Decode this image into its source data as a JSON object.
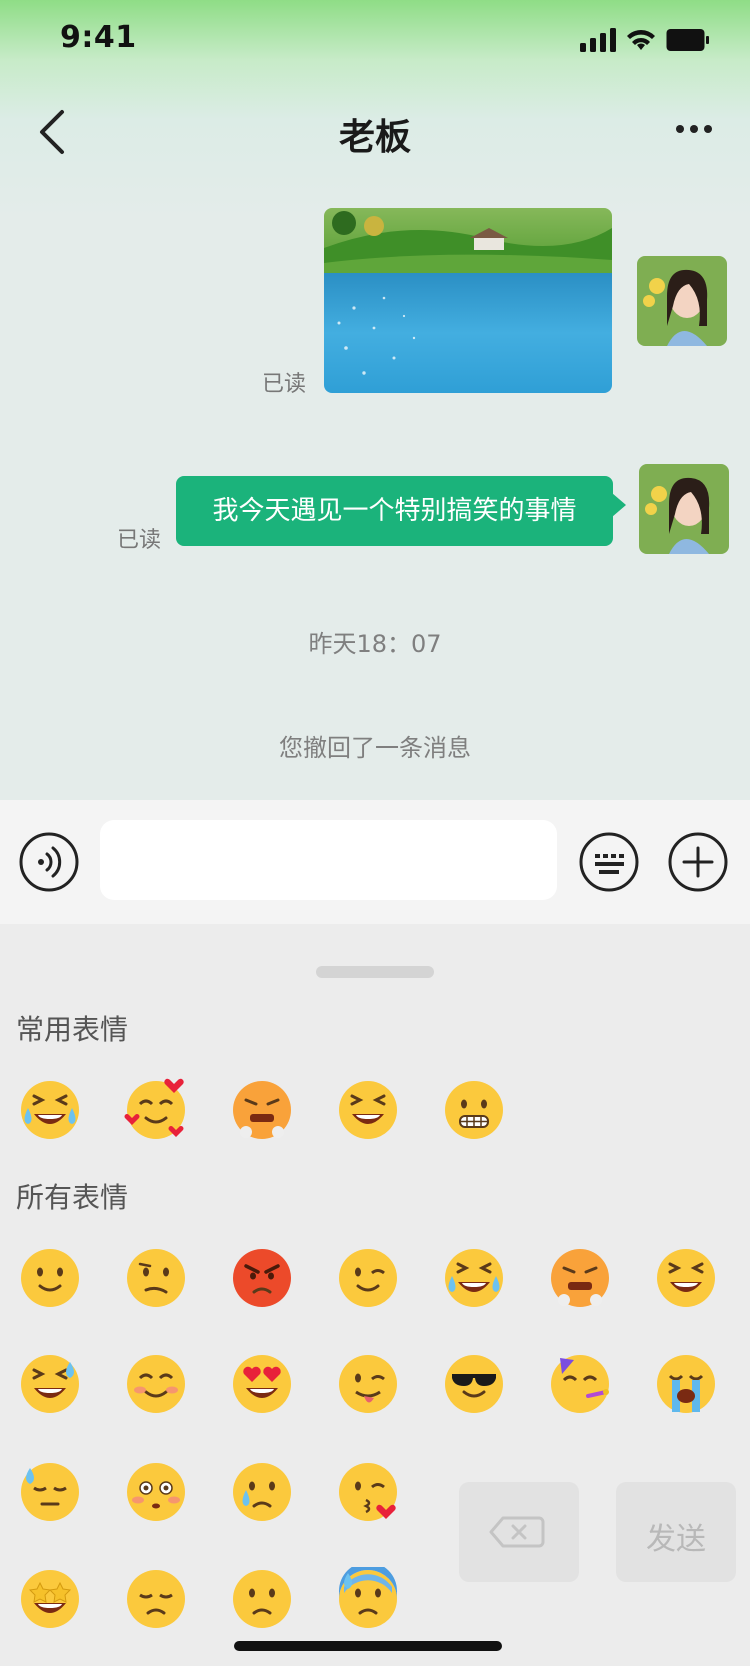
{
  "status_bar": {
    "time": "9:41"
  },
  "header": {
    "title": "老板"
  },
  "messages": {
    "read_label_1": "已读",
    "read_label_2": "已读",
    "text_message": "我今天遇见一个特别搞笑的事情",
    "timestamp": "昨天18：07",
    "recall_notice": "您撤回了一条消息"
  },
  "input": {
    "placeholder": ""
  },
  "emoji_panel": {
    "frequent_title": "常用表情",
    "all_title": "所有表情",
    "frequent": [
      "tears-of-joy",
      "smiling-hearts",
      "steam-from-nose",
      "grinning-squint",
      "grimacing"
    ],
    "all": [
      [
        "slightly-smiling",
        "confused",
        "pouting-angry",
        "winking",
        "tears-of-joy",
        "steam-from-nose",
        "grinning-squint"
      ],
      [
        "grinning-sweat",
        "smiling-blush",
        "heart-eyes",
        "tongue-wink",
        "sunglasses",
        "partying",
        "loudly-crying"
      ],
      [
        "downcast-sweat",
        "flushed",
        "sad-tear",
        "kissing-heart"
      ],
      [
        "star-struck",
        "pensive",
        "frowning",
        "anxious-sweat"
      ]
    ],
    "send_label": "发送"
  },
  "colors": {
    "accent": "#1bb37b",
    "bg_top": "#8fdd86",
    "chat_bg": "#e4ecea"
  }
}
